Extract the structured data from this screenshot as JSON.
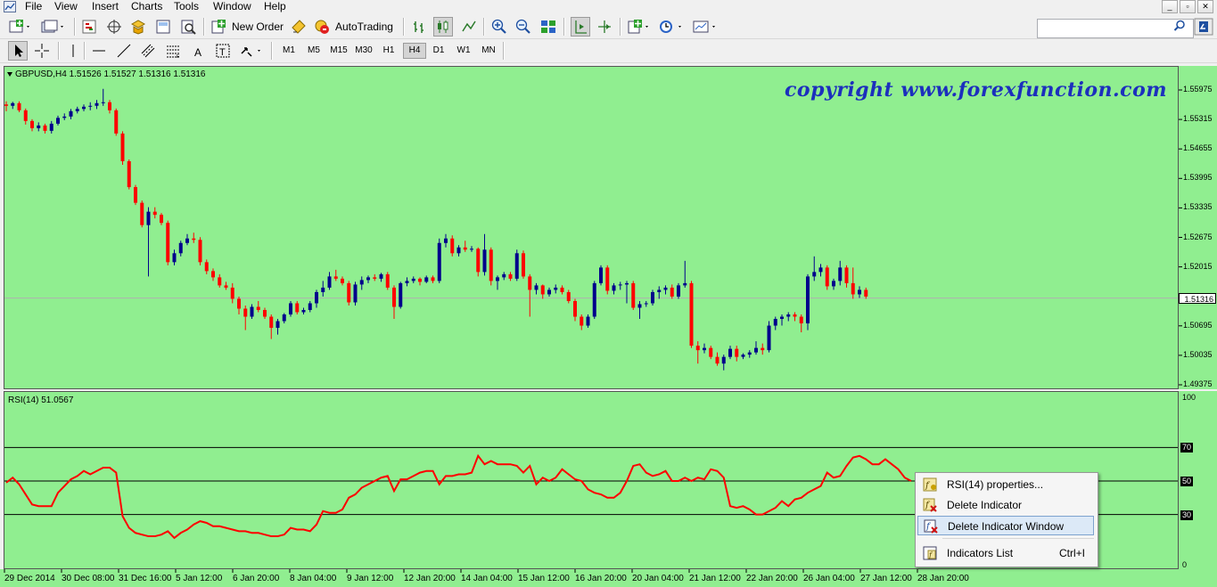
{
  "menu": [
    "File",
    "View",
    "Insert",
    "Charts",
    "Tools",
    "Window",
    "Help"
  ],
  "toolbar": {
    "new_order": "New Order",
    "autotrading": "AutoTrading",
    "tool_letter_a": "A",
    "timeframes": [
      "M1",
      "M5",
      "M15",
      "M30",
      "H1",
      "H4",
      "D1",
      "W1",
      "MN"
    ],
    "active_timeframe": "H4"
  },
  "chart": {
    "title": "GBPUSD,H4  1.51526 1.51527 1.51316 1.51316",
    "symbol": "GBPUSD",
    "timeframe": "H4",
    "watermark": "copyright www.forexfunction.com",
    "price_labels": [
      "1.55975",
      "1.55315",
      "1.54655",
      "1.53995",
      "1.53335",
      "1.52675",
      "1.52015",
      "1.51316",
      "1.50695",
      "1.50035",
      "1.49375"
    ],
    "current_price": "1.51316",
    "time_labels": [
      "29 Dec 2014",
      "30 Dec 08:00",
      "31 Dec 16:00",
      "5 Jan 12:00",
      "6 Jan 20:00",
      "8 Jan 04:00",
      "9 Jan 12:00",
      "12 Jan 20:00",
      "14 Jan 04:00",
      "15 Jan 12:00",
      "16 Jan 20:00",
      "20 Jan 04:00",
      "21 Jan 12:00",
      "22 Jan 20:00",
      "26 Jan 04:00",
      "27 Jan 12:00",
      "28 Jan 20:00"
    ],
    "bull_color": "#00008b",
    "bear_color": "#ff0000",
    "background": "#90ee90"
  },
  "rsi": {
    "title": "RSI(14) 51.0567",
    "scale": [
      "100",
      "70",
      "50",
      "30",
      "0"
    ],
    "line_color": "#ff0000"
  },
  "context_menu": {
    "items": [
      {
        "label": "RSI(14) properties...",
        "shortcut": "",
        "icon": "properties-icon"
      },
      {
        "label": "Delete Indicator",
        "shortcut": "",
        "icon": "delete-indicator-icon"
      },
      {
        "label": "Delete Indicator Window",
        "shortcut": "",
        "icon": "delete-window-icon",
        "highlighted": true
      },
      {
        "label": "Indicators List",
        "shortcut": "Ctrl+I",
        "icon": "indicators-list-icon"
      }
    ]
  },
  "search": {
    "placeholder": ""
  }
}
